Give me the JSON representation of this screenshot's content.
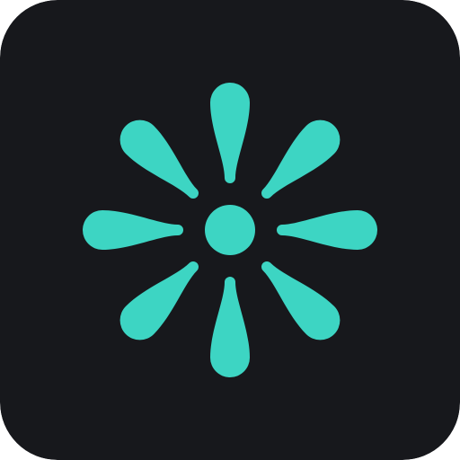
{
  "icon": {
    "name": "app-icon",
    "glyph": "asterisk-flower-icon",
    "colors": {
      "background": "#17181c",
      "accent": "#3dd5c3"
    },
    "petal_count": 8
  }
}
